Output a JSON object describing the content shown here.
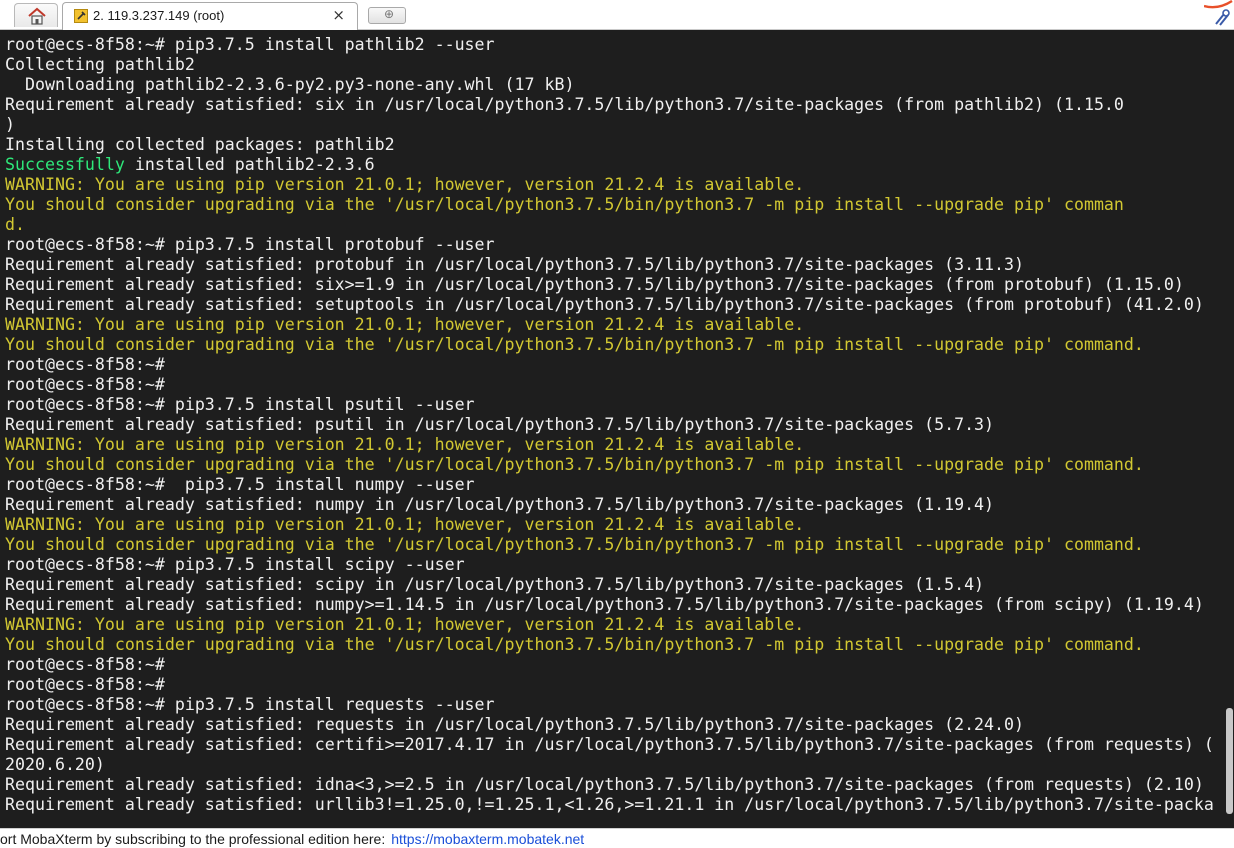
{
  "window": {
    "tab_title": "2. 119.3.237.149 (root)",
    "tab_close": "×",
    "newtab_symbol": "⊕"
  },
  "terminal": {
    "lines": [
      {
        "segments": [
          {
            "text": "root@ecs-8f58:~# pip3.7.5 install pathlib2 --user",
            "color": "default"
          }
        ]
      },
      {
        "segments": [
          {
            "text": "Collecting pathlib2",
            "color": "default"
          }
        ]
      },
      {
        "segments": [
          {
            "text": "  Downloading pathlib2-2.3.6-py2.py3-none-any.whl (17 kB)",
            "color": "default"
          }
        ]
      },
      {
        "segments": [
          {
            "text": "Requirement already satisfied: six in /usr/local/python3.7.5/lib/python3.7/site-packages (from pathlib2) (1.15.0",
            "color": "default"
          }
        ]
      },
      {
        "segments": [
          {
            "text": ")",
            "color": "default"
          }
        ]
      },
      {
        "segments": [
          {
            "text": "Installing collected packages: pathlib2",
            "color": "default"
          }
        ]
      },
      {
        "segments": [
          {
            "text": "Successfully",
            "color": "green"
          },
          {
            "text": " installed pathlib2-2.3.6",
            "color": "default"
          }
        ]
      },
      {
        "segments": [
          {
            "text": "WARNING: You are using pip version 21.0.1; however, version 21.2.4 is available.",
            "color": "warn"
          }
        ]
      },
      {
        "segments": [
          {
            "text": "You should consider upgrading via the '/usr/local/python3.7.5/bin/python3.7 -m pip install --upgrade pip' comman",
            "color": "warn"
          }
        ]
      },
      {
        "segments": [
          {
            "text": "d.",
            "color": "warn"
          }
        ]
      },
      {
        "segments": [
          {
            "text": "root@ecs-8f58:~# pip3.7.5 install protobuf --user",
            "color": "default"
          }
        ]
      },
      {
        "segments": [
          {
            "text": "Requirement already satisfied: protobuf in /usr/local/python3.7.5/lib/python3.7/site-packages (3.11.3)",
            "color": "default"
          }
        ]
      },
      {
        "segments": [
          {
            "text": "Requirement already satisfied: six>=1.9 in /usr/local/python3.7.5/lib/python3.7/site-packages (from protobuf) (1.15.0)",
            "color": "default"
          }
        ]
      },
      {
        "segments": [
          {
            "text": "Requirement already satisfied: setuptools in /usr/local/python3.7.5/lib/python3.7/site-packages (from protobuf) (41.2.0)",
            "color": "default"
          }
        ]
      },
      {
        "segments": [
          {
            "text": "WARNING: You are using pip version 21.0.1; however, version 21.2.4 is available.",
            "color": "warn"
          }
        ]
      },
      {
        "segments": [
          {
            "text": "You should consider upgrading via the '/usr/local/python3.7.5/bin/python3.7 -m pip install --upgrade pip' command.",
            "color": "warn"
          }
        ]
      },
      {
        "segments": [
          {
            "text": "root@ecs-8f58:~#",
            "color": "default"
          }
        ]
      },
      {
        "segments": [
          {
            "text": "root@ecs-8f58:~#",
            "color": "default"
          }
        ]
      },
      {
        "segments": [
          {
            "text": "root@ecs-8f58:~# pip3.7.5 install psutil --user",
            "color": "default"
          }
        ]
      },
      {
        "segments": [
          {
            "text": "Requirement already satisfied: psutil in /usr/local/python3.7.5/lib/python3.7/site-packages (5.7.3)",
            "color": "default"
          }
        ]
      },
      {
        "segments": [
          {
            "text": "WARNING: You are using pip version 21.0.1; however, version 21.2.4 is available.",
            "color": "warn"
          }
        ]
      },
      {
        "segments": [
          {
            "text": "You should consider upgrading via the '/usr/local/python3.7.5/bin/python3.7 -m pip install --upgrade pip' command.",
            "color": "warn"
          }
        ]
      },
      {
        "segments": [
          {
            "text": "root@ecs-8f58:~#  pip3.7.5 install numpy --user",
            "color": "default"
          }
        ]
      },
      {
        "segments": [
          {
            "text": "Requirement already satisfied: numpy in /usr/local/python3.7.5/lib/python3.7/site-packages (1.19.4)",
            "color": "default"
          }
        ]
      },
      {
        "segments": [
          {
            "text": "WARNING: You are using pip version 21.0.1; however, version 21.2.4 is available.",
            "color": "warn"
          }
        ]
      },
      {
        "segments": [
          {
            "text": "You should consider upgrading via the '/usr/local/python3.7.5/bin/python3.7 -m pip install --upgrade pip' command.",
            "color": "warn"
          }
        ]
      },
      {
        "segments": [
          {
            "text": "root@ecs-8f58:~# pip3.7.5 install scipy --user",
            "color": "default"
          }
        ]
      },
      {
        "segments": [
          {
            "text": "Requirement already satisfied: scipy in /usr/local/python3.7.5/lib/python3.7/site-packages (1.5.4)",
            "color": "default"
          }
        ]
      },
      {
        "segments": [
          {
            "text": "Requirement already satisfied: numpy>=1.14.5 in /usr/local/python3.7.5/lib/python3.7/site-packages (from scipy) (1.19.4)",
            "color": "default"
          }
        ]
      },
      {
        "segments": [
          {
            "text": "WARNING: You are using pip version 21.0.1; however, version 21.2.4 is available.",
            "color": "warn"
          }
        ]
      },
      {
        "segments": [
          {
            "text": "You should consider upgrading via the '/usr/local/python3.7.5/bin/python3.7 -m pip install --upgrade pip' command.",
            "color": "warn"
          }
        ]
      },
      {
        "segments": [
          {
            "text": "root@ecs-8f58:~#",
            "color": "default"
          }
        ]
      },
      {
        "segments": [
          {
            "text": "root@ecs-8f58:~#",
            "color": "default"
          }
        ]
      },
      {
        "segments": [
          {
            "text": "root@ecs-8f58:~# pip3.7.5 install requests --user",
            "color": "default"
          }
        ]
      },
      {
        "segments": [
          {
            "text": "Requirement already satisfied: requests in /usr/local/python3.7.5/lib/python3.7/site-packages (2.24.0)",
            "color": "default"
          }
        ]
      },
      {
        "segments": [
          {
            "text": "Requirement already satisfied: certifi>=2017.4.17 in /usr/local/python3.7.5/lib/python3.7/site-packages (from requests) (",
            "color": "default"
          }
        ]
      },
      {
        "segments": [
          {
            "text": "2020.6.20)",
            "color": "default"
          }
        ]
      },
      {
        "segments": [
          {
            "text": "Requirement already satisfied: idna<3,>=2.5 in /usr/local/python3.7.5/lib/python3.7/site-packages (from requests) (2.10)",
            "color": "default"
          }
        ]
      },
      {
        "segments": [
          {
            "text": "Requirement already satisfied: urllib3!=1.25.0,!=1.25.1,<1.26,>=1.21.1 in /usr/local/python3.7.5/lib/python3.7/site-packa",
            "color": "default"
          }
        ]
      }
    ]
  },
  "statusbar": {
    "text": "ort MobaXterm by subscribing to the professional edition here:",
    "link": "https://mobaxterm.mobatek.net"
  },
  "colors": {
    "terminal_bg": "#1e1e1e",
    "default_text": "#f0f0f0",
    "warning_text": "#d2c832",
    "success_text": "#2ee87a",
    "link": "#1a4fd8"
  }
}
